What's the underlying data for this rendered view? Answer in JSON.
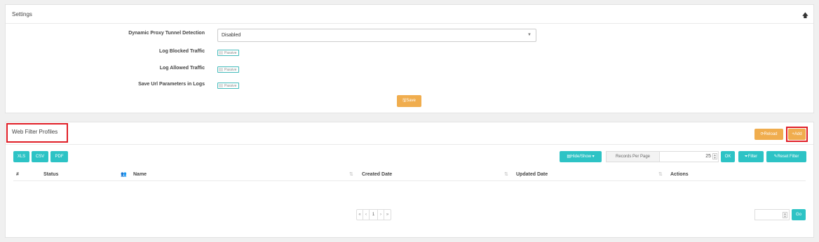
{
  "settings": {
    "title": "Settings",
    "collapse_icon": "arrow-up-icon",
    "fields": {
      "proxy_label": "Dynamic Proxy Tunnel Detection",
      "proxy_value": "Disabled",
      "blocked_label": "Log Blocked Traffic",
      "blocked_toggle": "Passive",
      "allowed_label": "Log Allowed Traffic",
      "allowed_toggle": "Passive",
      "urlparams_label": "Save Url Parameters in Logs",
      "urlparams_toggle": "Passive"
    },
    "save_label": "Save"
  },
  "profiles": {
    "title": "Web Filter Profiles",
    "reload_label": "Reload",
    "add_label": "+Add",
    "export": {
      "xls": "XLS",
      "csv": "CSV",
      "pdf": "PDF"
    },
    "hideshow_label": "Hide/Show",
    "rpp_label": "Records Per Page",
    "rpp_value": "25",
    "ok_label": "OK",
    "filter_label": "Filter",
    "reset_filter_label": "Reset Filter",
    "columns": [
      "#",
      "Status",
      "Name",
      "Created Date",
      "Updated Date",
      "Actions"
    ],
    "pager": {
      "first": "«",
      "prev": "‹",
      "page": "1",
      "next": "›",
      "last": "»"
    },
    "go_label": "Go"
  },
  "colors": {
    "accent_orange": "#f0ad4e",
    "accent_teal": "#2dc3c5",
    "highlight": "#e01e26"
  }
}
